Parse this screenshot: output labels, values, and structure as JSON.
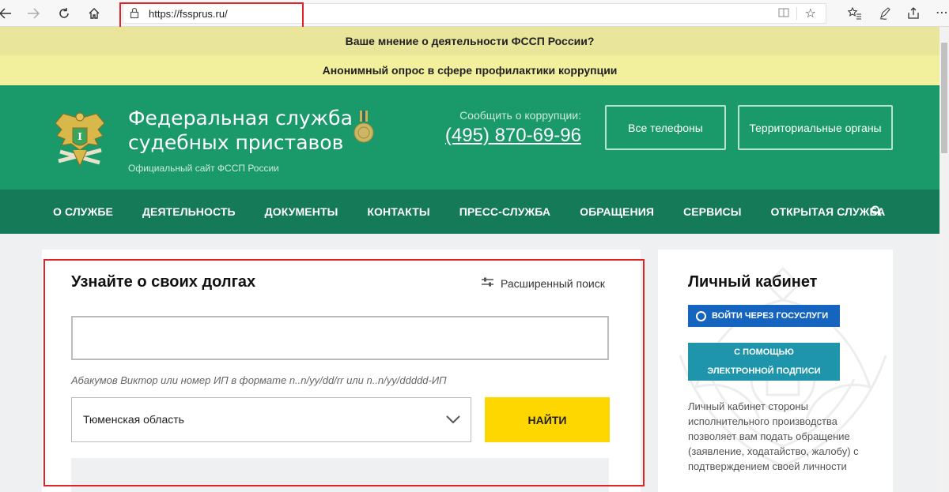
{
  "browser": {
    "url": "https://fssprus.ru/",
    "icons": [
      "back-icon",
      "forward-icon",
      "refresh-icon",
      "home-icon",
      "lock-icon",
      "reader-icon",
      "favorite-icon",
      "favorites-list-icon",
      "pen-icon",
      "share-icon",
      "more-icon"
    ]
  },
  "banners": {
    "opinion": "Ваше мнение о деятельности ФССП России?",
    "survey": "Анонимный опрос в сфере профилактики коррупции"
  },
  "header": {
    "title_line1": "Федеральная служба",
    "title_line2": "судебных приставов",
    "subtitle": "Официальный сайт ФССП России",
    "corruption_label": "Сообщить о коррупции:",
    "corruption_phone": "(495) 870-69-96",
    "buttons": [
      "Все телефоны",
      "Территориальные органы"
    ]
  },
  "nav": {
    "items": [
      "О СЛУЖБЕ",
      "ДЕЯТЕЛЬНОСТЬ",
      "ДОКУМЕНТЫ",
      "КОНТАКТЫ",
      "ПРЕСС-СЛУЖБА",
      "ОБРАЩЕНИЯ",
      "СЕРВИСЫ",
      "ОТКРЫТАЯ СЛУЖБА"
    ]
  },
  "debt_search": {
    "title": "Узнайте о своих долгах",
    "advanced_search": "Расширенный поиск",
    "input_value": "",
    "hint": "Абакумов Виктор или номер ИП в формате n..n/yy/dd/rr или n..n/yy/ddddd-ИП",
    "region": "Тюменская область",
    "find_button": "НАЙТИ"
  },
  "cabinet": {
    "title": "Личный кабинет",
    "gosuslugi_button": "ВОЙТИ ЧЕРЕЗ ГОСУСЛУГИ",
    "signature_button_line1": "С ПОМОЩЬЮ",
    "signature_button_line2": "ЭЛЕКТРОННОЙ ПОДПИСИ",
    "description": "Личный кабинет стороны исполнительного производства позволяет вам подать обращение (заявление, ходатайство, жалобу) с подтверждением своей личности"
  },
  "colors": {
    "header_green": "#1a9a6b",
    "nav_green": "#147a57",
    "banner_yellow": "#f3f09d",
    "find_button_yellow": "#ffd700",
    "gosuslugi_blue": "#1565c0",
    "signature_teal": "#1e95ab",
    "highlight_red": "#e32227"
  }
}
